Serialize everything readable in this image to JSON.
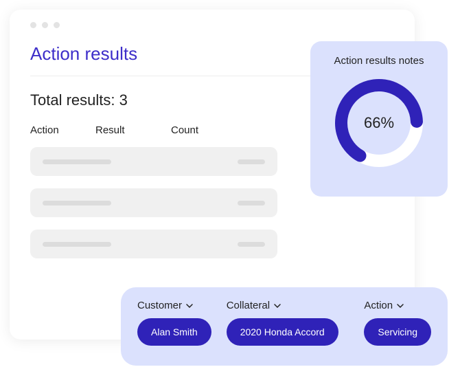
{
  "title": "Action results",
  "total_label": "Total results: 3",
  "columns": {
    "action": "Action",
    "result": "Result",
    "count": "Count"
  },
  "notes": {
    "title": "Action results notes",
    "percent_label": "66%",
    "percent": 66
  },
  "filters": {
    "customer": {
      "label": "Customer",
      "value": "Alan Smith"
    },
    "collateral": {
      "label": "Collateral",
      "value": "2020 Honda Accord"
    },
    "action": {
      "label": "Action",
      "value": "Servicing"
    }
  },
  "colors": {
    "accent": "#2f22b8",
    "panel": "#dbe1fd"
  }
}
